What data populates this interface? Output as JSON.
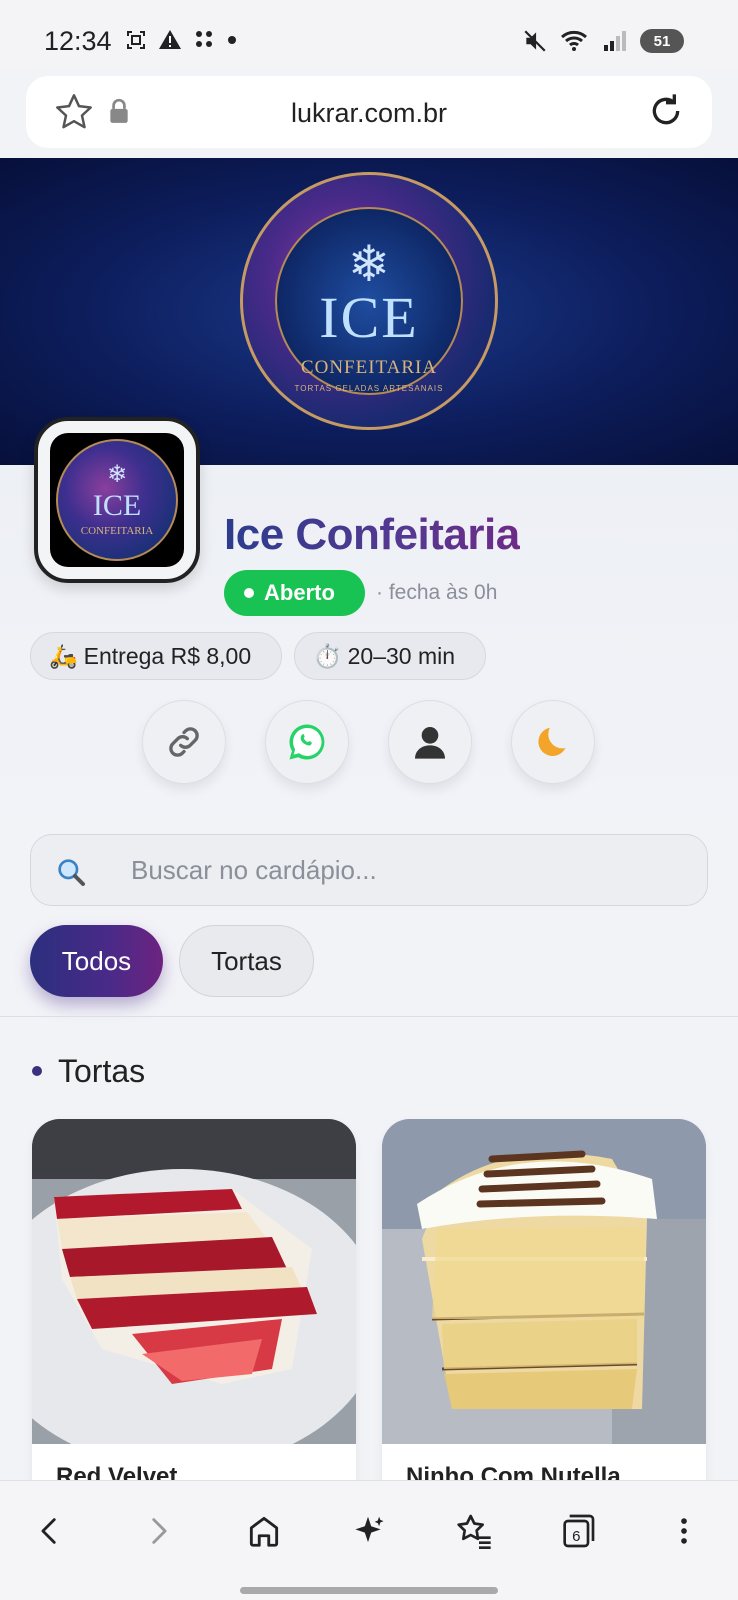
{
  "status_bar": {
    "time": "12:34",
    "battery": "51",
    "icons": [
      "screenshot-icon",
      "warning-icon",
      "dots-icon",
      "dot-icon",
      "mute-icon",
      "wifi-icon",
      "signal-icon"
    ]
  },
  "browser": {
    "url": "lukrar.com.br"
  },
  "banner": {
    "logo_main": "ICE",
    "logo_secondary": "CONFEITARIA",
    "logo_tagline": "TORTAS GELADAS ARTESANAIS"
  },
  "store": {
    "name": "Ice Confeitaria",
    "status": "Aberto",
    "closes": "· fecha às 0h",
    "delivery": "Entrega R$ 8,00",
    "delivery_icon": "🛵",
    "time": "20–30 min",
    "time_icon": "⏱️",
    "avatar_main": "ICE",
    "avatar_secondary": "CONFEITARIA"
  },
  "actions": [
    "link-icon",
    "whatsapp-icon",
    "user-icon",
    "moon-icon"
  ],
  "search": {
    "placeholder": "Buscar no cardápio..."
  },
  "tabs": [
    {
      "label": "Todos",
      "active": true
    },
    {
      "label": "Tortas",
      "active": false
    }
  ],
  "section": {
    "title": "Tortas"
  },
  "products": [
    {
      "name": "Red Velvet"
    },
    {
      "name": "Ninho Com Nutella"
    }
  ],
  "bottom_nav": {
    "tab_count": "6"
  },
  "colors": {
    "accent": "#4a2a88",
    "open_green": "#19c353",
    "banner_dark": "#0d1d5c"
  }
}
